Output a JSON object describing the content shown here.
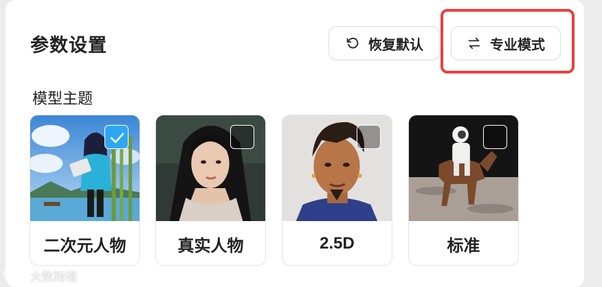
{
  "panel": {
    "title": "参数设置",
    "restore_label": "恢复默认",
    "pro_mode_label": "专业模式",
    "section_label": "模型主题"
  },
  "themes": [
    {
      "label": "二次元人物",
      "selected": true,
      "icon": "anime-girl-image"
    },
    {
      "label": "真实人物",
      "selected": false,
      "icon": "realistic-woman-image"
    },
    {
      "label": "2.5D",
      "selected": false,
      "icon": "2-5d-man-image"
    },
    {
      "label": "标准",
      "selected": false,
      "icon": "astronaut-horse-image"
    }
  ],
  "watermark": "大数跨境",
  "colors": {
    "accent": "#2fa7f0",
    "highlight": "#e8413c"
  }
}
